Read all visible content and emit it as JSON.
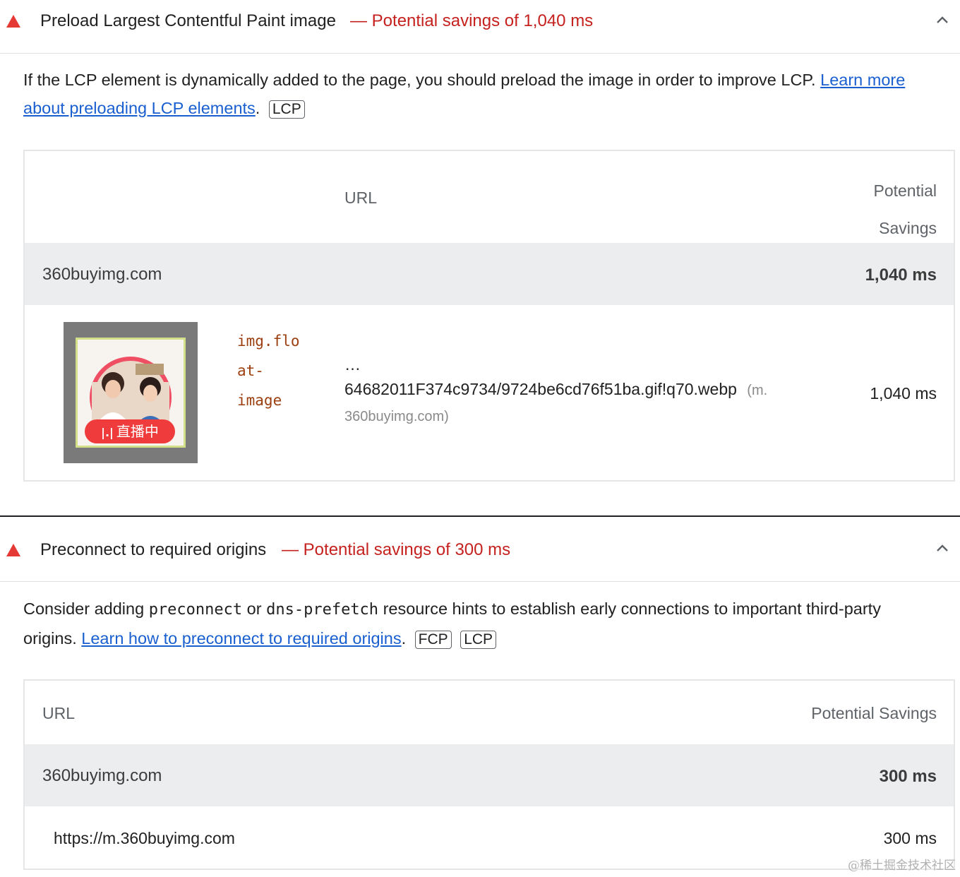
{
  "audit1": {
    "title": "Preload Largest Contentful Paint image",
    "savings": "— Potential savings of 1,040 ms",
    "desc_text": "If the LCP element is dynamically added to the page, you should preload the image in order to improve LCP.",
    "link_text": "Learn more about preloading LCP elements",
    "tags": [
      "LCP"
    ],
    "table": {
      "col_url": "URL",
      "col_savings_line1": "Potential",
      "col_savings_line2": "Savings",
      "group_host": "360buyimg.com",
      "group_value": "1,040 ms",
      "row": {
        "thumb_badge": "直播中",
        "selector_lines": [
          "img.flo",
          "at-",
          "image"
        ],
        "ellipsis": "…",
        "url_main": "64682011F374c9734/9724be6cd76f51ba.gif!q70.webp",
        "url_host_part1": "(m.",
        "url_host_part2": "360buyimg.com)",
        "value": "1,040 ms"
      }
    }
  },
  "audit2": {
    "title": "Preconnect to required origins",
    "savings": "— Potential savings of 300 ms",
    "desc_pre": "Consider adding",
    "code1": "preconnect",
    "desc_or": "or",
    "code2": "dns-prefetch",
    "desc_post": "resource hints to establish early connections to important third-party origins.",
    "link_text": "Learn how to preconnect to required origins",
    "tags": [
      "FCP",
      "LCP"
    ],
    "table": {
      "col_url": "URL",
      "col_savings": "Potential Savings",
      "group_host": "360buyimg.com",
      "group_value": "300 ms",
      "row_url": "https://m.360buyimg.com",
      "row_value": "300 ms"
    }
  },
  "watermark": "@稀土掘金技术社区",
  "colors": {
    "warning": "#e53935",
    "savings": "#c5221f",
    "link": "#1a5fd0",
    "group_bg": "#ebedef",
    "selector": "#9c3f10"
  }
}
